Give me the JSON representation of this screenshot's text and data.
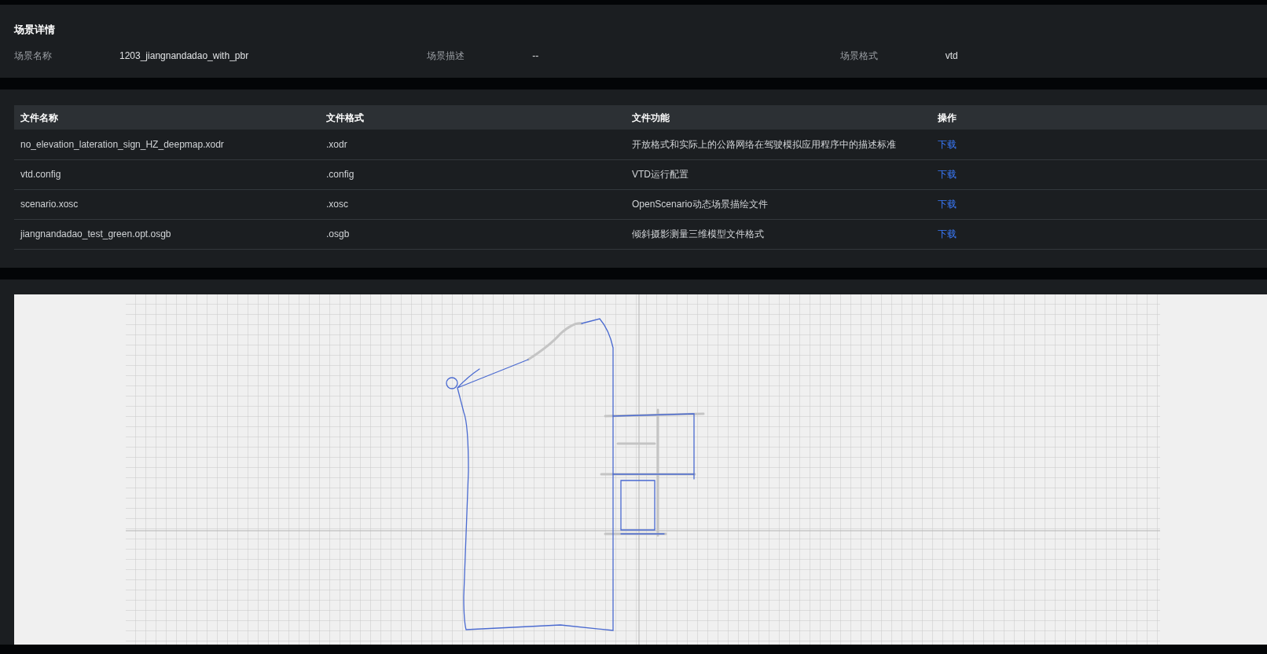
{
  "scene_details": {
    "title": "场景详情",
    "fields": [
      {
        "label": "场景名称",
        "value": "1203_jiangnandadao_with_pbr"
      },
      {
        "label": "场景描述",
        "value": "--"
      },
      {
        "label": "场景格式",
        "value": "vtd"
      }
    ]
  },
  "files_table": {
    "columns": [
      "文件名称",
      "文件格式",
      "文件功能",
      "操作"
    ],
    "rows": [
      {
        "name": "no_elevation_lateration_sign_HZ_deepmap.xodr",
        "format": ".xodr",
        "function": "开放格式和实际上的公路网络在驾驶模拟应用程序中的描述标准",
        "action": "下载"
      },
      {
        "name": "vtd.config",
        "format": ".config",
        "function": "VTD运行配置",
        "action": "下载"
      },
      {
        "name": "scenario.xosc",
        "format": ".xosc",
        "function": "OpenScenario动态场景描绘文件",
        "action": "下载"
      },
      {
        "name": "jiangnandadao_test_green.opt.osgb",
        "format": ".osgb",
        "function": "倾斜摄影测量三维模型文件格式",
        "action": "下载"
      }
    ]
  }
}
